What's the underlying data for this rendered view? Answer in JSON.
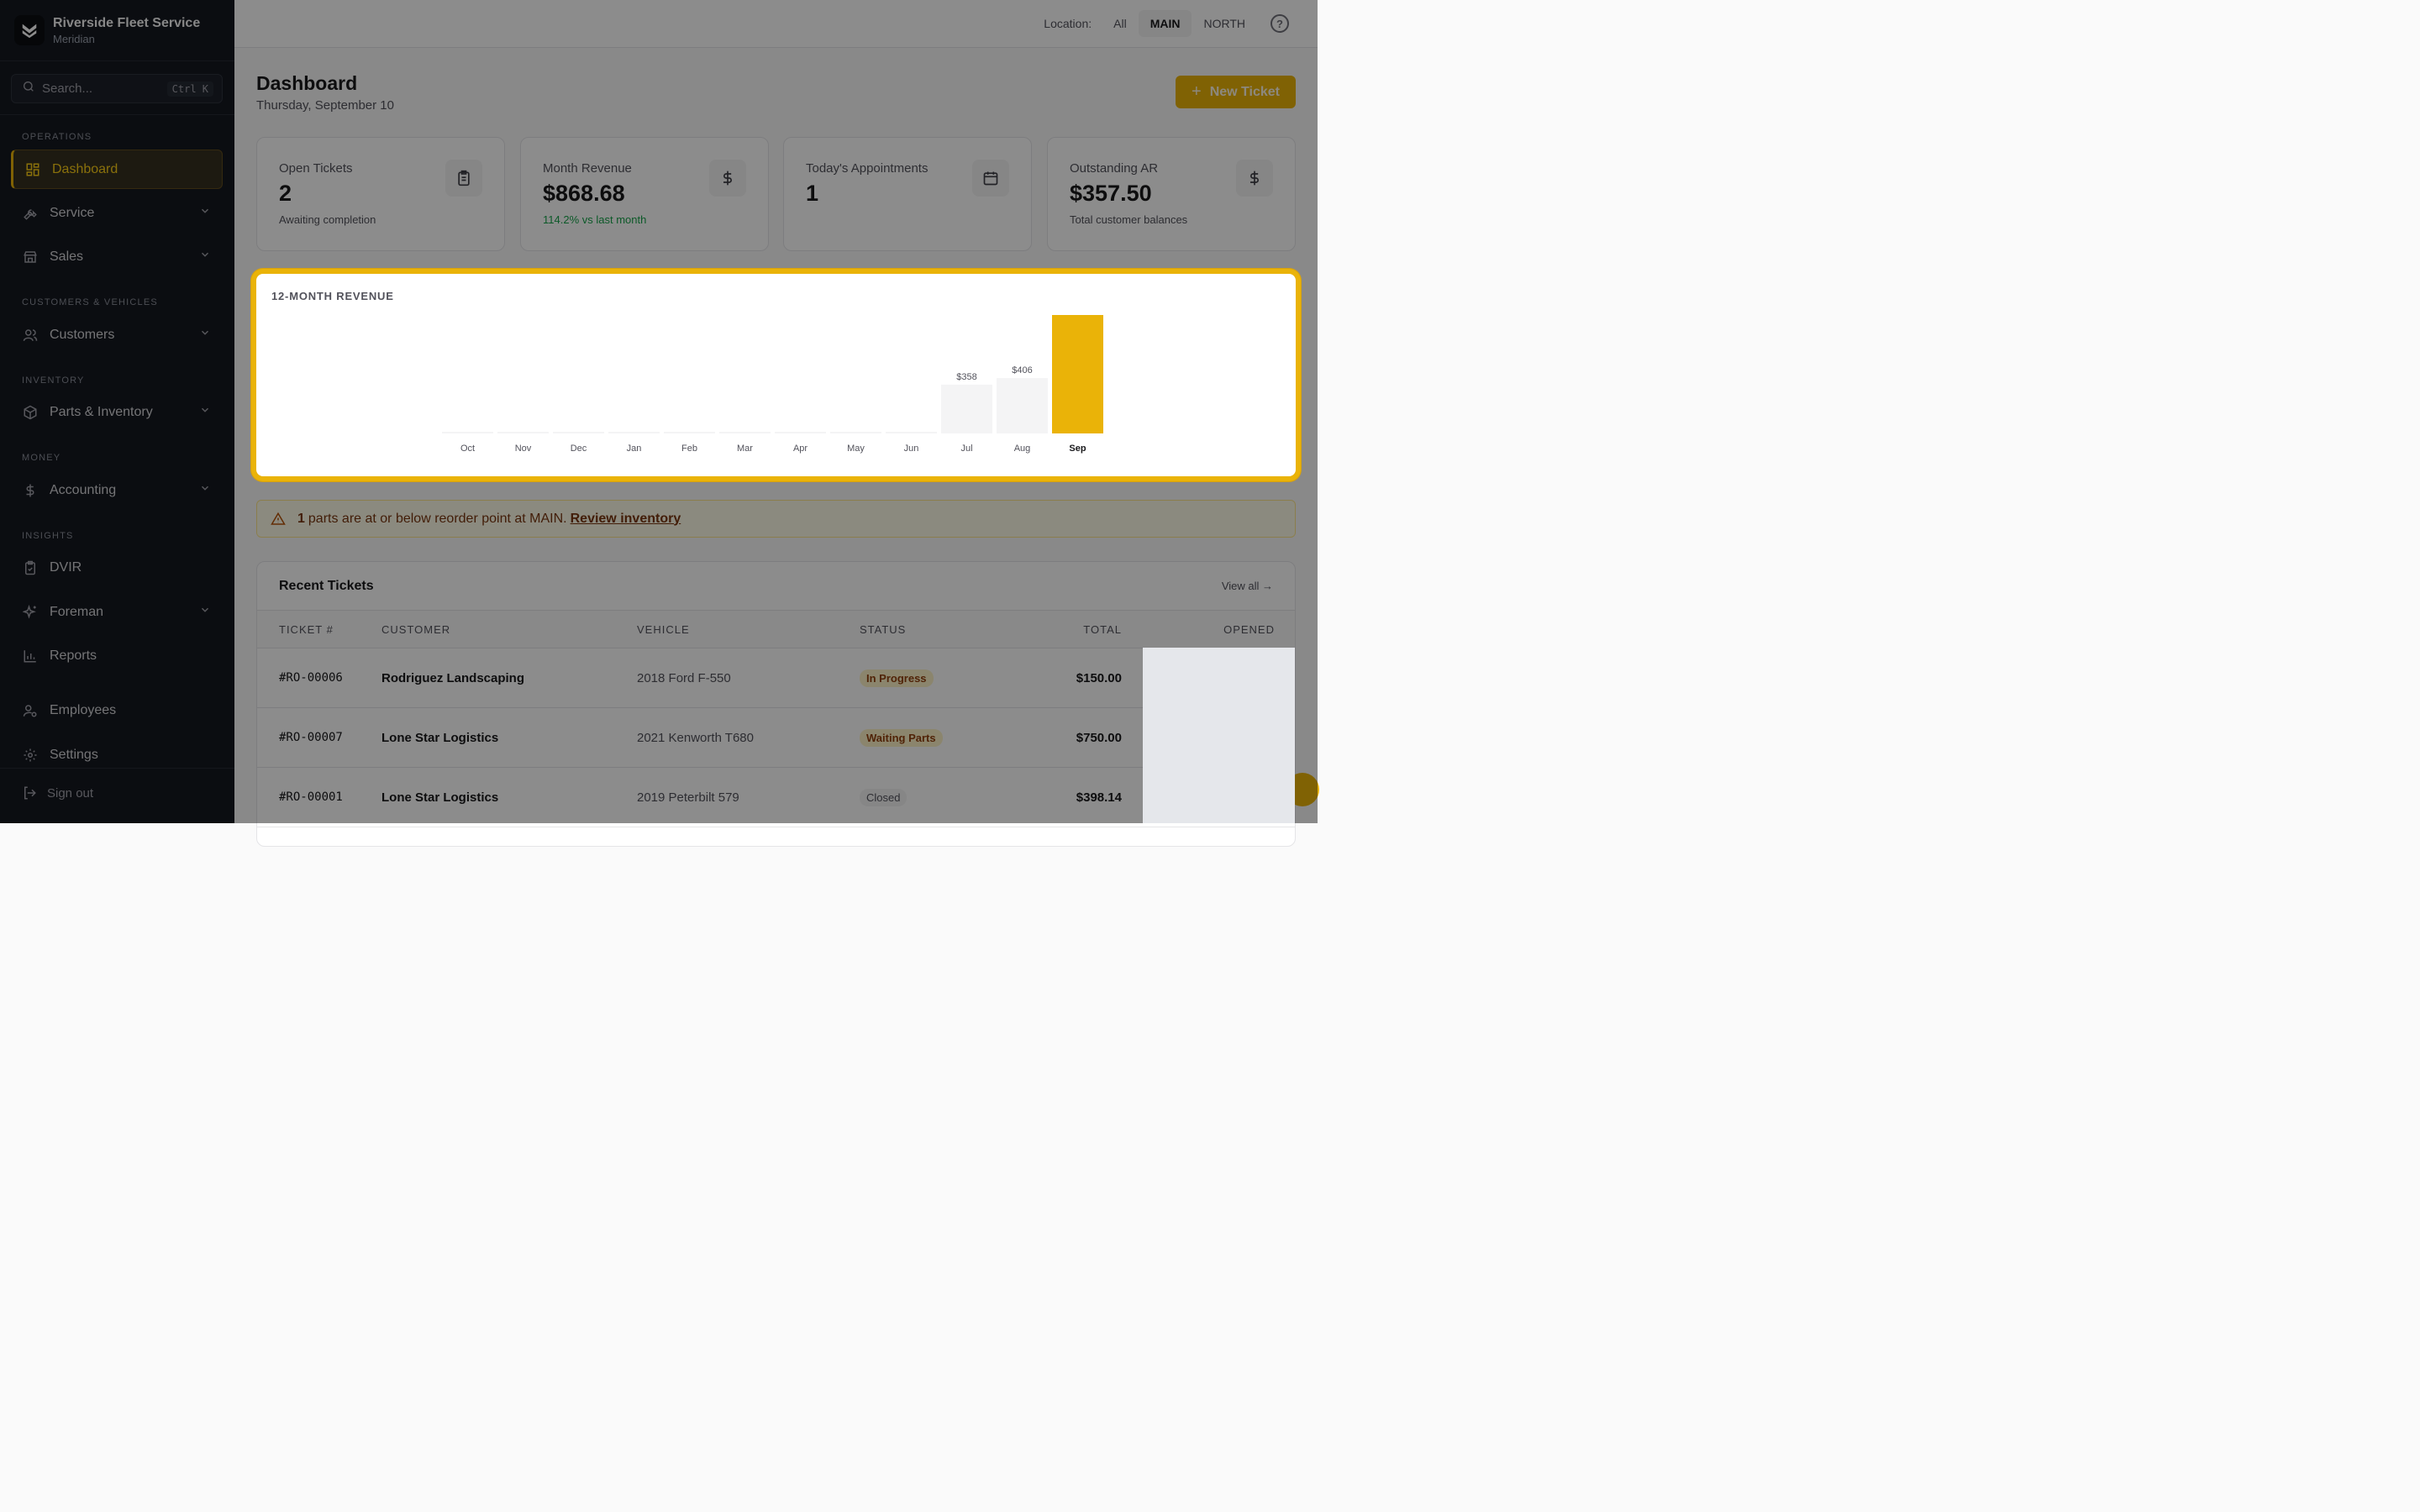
{
  "brand": {
    "name": "Riverside Fleet Service",
    "sub": "Meridian"
  },
  "search": {
    "placeholder": "Search...",
    "shortcut": "Ctrl K"
  },
  "sidebar": {
    "sections": {
      "operations": "OPERATIONS",
      "customers": "CUSTOMERS & VEHICLES",
      "inventory": "INVENTORY",
      "money": "MONEY",
      "insights": "INSIGHTS"
    },
    "items": [
      {
        "label": "Dashboard",
        "icon": "dashboard-icon",
        "active": true
      },
      {
        "label": "Service",
        "icon": "wrench-icon"
      },
      {
        "label": "Sales",
        "icon": "store-icon"
      },
      {
        "label": "Customers",
        "icon": "users-icon"
      },
      {
        "label": "Parts & Inventory",
        "icon": "box-icon"
      },
      {
        "label": "Accounting",
        "icon": "dollar-icon"
      },
      {
        "label": "DVIR",
        "icon": "clipboard-check-icon"
      },
      {
        "label": "Foreman",
        "icon": "sparkle-icon"
      },
      {
        "label": "Reports",
        "icon": "bar-chart-icon"
      },
      {
        "label": "Employees",
        "icon": "user-gear-icon"
      },
      {
        "label": "Settings",
        "icon": "gear-icon"
      }
    ],
    "signout": "Sign out"
  },
  "topbar": {
    "location_label": "Location:",
    "options": [
      "All",
      "MAIN",
      "NORTH"
    ],
    "selected": "MAIN"
  },
  "header": {
    "title": "Dashboard",
    "date": "Thursday, September 10",
    "new_ticket": "New Ticket"
  },
  "stats": [
    {
      "label": "Open Tickets",
      "value": "2",
      "sub": "Awaiting completion",
      "icon": "clipboard-icon"
    },
    {
      "label": "Month Revenue",
      "value": "$868.68",
      "sub": "114.2% vs last month",
      "icon": "dollar-icon"
    },
    {
      "label": "Today's Appointments",
      "value": "1",
      "sub": "",
      "icon": "calendar-icon"
    },
    {
      "label": "Outstanding AR",
      "value": "$357.50",
      "sub": "Total customer balances",
      "icon": "dollar-icon"
    }
  ],
  "chart_data": {
    "type": "bar",
    "title": "12-MONTH REVENUE",
    "categories": [
      "Oct",
      "Nov",
      "Dec",
      "Jan",
      "Feb",
      "Mar",
      "Apr",
      "May",
      "Jun",
      "Jul",
      "Aug",
      "Sep"
    ],
    "values": [
      0,
      0,
      0,
      0,
      0,
      0,
      0,
      0,
      0,
      358,
      406,
      868.68
    ],
    "data_labels": [
      "",
      "",
      "",
      "",
      "",
      "",
      "",
      "",
      "",
      "$358",
      "$406",
      ""
    ],
    "highlight": "Sep",
    "highlight_color": "#eab308",
    "bar_color": "#f4f4f5",
    "xlabel": "",
    "ylabel": ""
  },
  "alert": {
    "count": "1",
    "text": "parts are at or below reorder point at MAIN.",
    "link": "Review inventory"
  },
  "tickets": {
    "title": "Recent Tickets",
    "view_all": "View all →",
    "columns": [
      "TICKET #",
      "CUSTOMER",
      "VEHICLE",
      "STATUS",
      "TOTAL",
      "OPENED"
    ],
    "rows": [
      {
        "ticket": "#RO-00006",
        "customer": "Rodriguez Landscaping",
        "vehicle": "2018 Ford F-550",
        "status": "In Progress",
        "total": "$150.00"
      },
      {
        "ticket": "#RO-00007",
        "customer": "Lone Star Logistics",
        "vehicle": "2021 Kenworth T680",
        "status": "Waiting Parts",
        "total": "$750.00"
      },
      {
        "ticket": "#RO-00001",
        "customer": "Lone Star Logistics",
        "vehicle": "2019 Peterbilt 579",
        "status": "Closed",
        "total": "$398.14"
      }
    ]
  },
  "colors": {
    "accent": "#eab308",
    "sidebar_bg": "#151820",
    "positive": "#16a34a"
  }
}
